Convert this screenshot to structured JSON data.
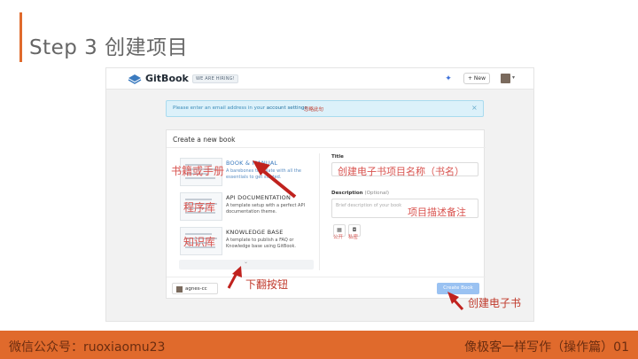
{
  "slide": {
    "title": "Step 3 创建项目",
    "footer_left": "微信公众号：ruoxiaomu23",
    "footer_right": "像极客一样写作（操作篇）01"
  },
  "navbar": {
    "brand": "GitBook",
    "hiring_badge": "WE ARE HIRING!",
    "new_button": "+ New"
  },
  "alert": {
    "text_prefix": "Please enter an email address in your ",
    "link_text": "account settings",
    "text_suffix": ".",
    "note": "忽略此句",
    "close": "×"
  },
  "panel": {
    "title": "Create a new book",
    "templates": [
      {
        "name": "BOOK & MANUAL",
        "desc": "A barebones template with all the essentials to get started.",
        "label": "书籍或手册"
      },
      {
        "name": "API DOCUMENTATION",
        "desc": "A template setup with a perfect API documentation theme.",
        "label": "程序库"
      },
      {
        "name": "KNOWLEDGE BASE",
        "desc": "A template to publish a FAQ or Knowledge base using GitBook.",
        "label": "知识库"
      }
    ],
    "title_label": "Title",
    "title_value": "创建电子书项目名称（书名）",
    "description_label": "Description",
    "description_optional": "(Optional)",
    "description_placeholder": "Brief description of your book",
    "description_note": "项目描述备注",
    "visibility": {
      "public_label": "公开",
      "private_label": "私密"
    },
    "owner": "agnes-cc",
    "create_button": "Create Book"
  },
  "annotations": {
    "scroll_down": "下翻按钮",
    "create_ebook": "创建电子书"
  },
  "colors": {
    "accent": "#e06a2c",
    "annotation_red": "#d9534f",
    "link_blue": "#3b7bbf",
    "create_button": "#9ac2f2",
    "alert_bg": "#dcf1fa"
  },
  "icons": [
    "gitbook-logo-icon",
    "star-icon",
    "globe-icon",
    "lock-icon",
    "chevron-down-icon",
    "close-icon",
    "arrow-icon"
  ]
}
